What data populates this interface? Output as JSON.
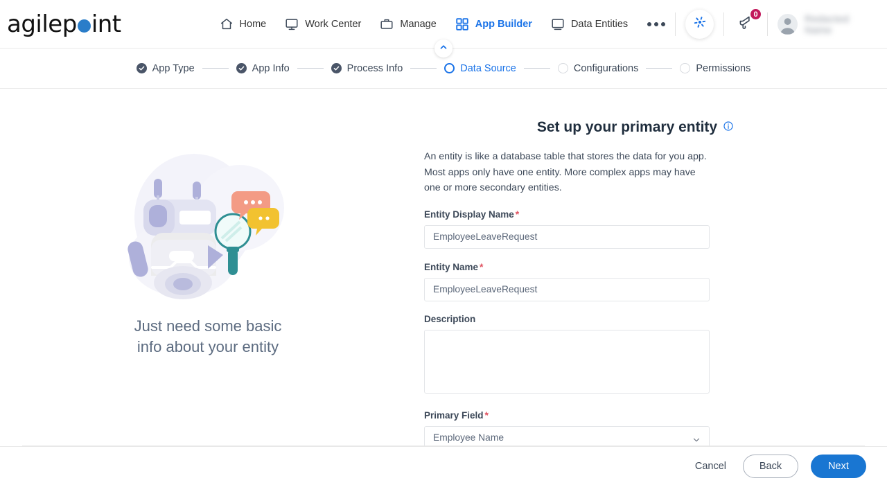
{
  "brand": {
    "name_part1": "agilep",
    "name_part2": "int",
    "dot_color": "#2a7dc9",
    "accent_color": "#1a73e8"
  },
  "nav": {
    "items": [
      {
        "label": "Home",
        "icon": "home-icon",
        "active": false
      },
      {
        "label": "Work Center",
        "icon": "monitor-icon",
        "active": false
      },
      {
        "label": "Manage",
        "icon": "briefcase-icon",
        "active": false
      },
      {
        "label": "App Builder",
        "icon": "grid-icon",
        "active": true
      },
      {
        "label": "Data Entities",
        "icon": "display-icon",
        "active": false
      }
    ],
    "more_label": "More"
  },
  "topbar_right": {
    "apps_icon": "pinwheel-icon",
    "announcement_icon": "megaphone-icon",
    "announcement_count": "0",
    "badge_color": "#c2185b",
    "avatar_icon": "user-avatar-icon",
    "user_name": "Redacted Name"
  },
  "wizard": {
    "collapse_icon": "chevron-up-icon",
    "steps": [
      {
        "label": "App Type",
        "state": "done"
      },
      {
        "label": "App Info",
        "state": "done"
      },
      {
        "label": "Process Info",
        "state": "done"
      },
      {
        "label": "Data Source",
        "state": "active"
      },
      {
        "label": "Configurations",
        "state": "todo"
      },
      {
        "label": "Permissions",
        "state": "todo"
      }
    ]
  },
  "illustration": {
    "caption_line1": "Just need some basic",
    "caption_line2": "info about your entity",
    "alt": "robot-with-magnifier-illustration"
  },
  "form": {
    "title": "Set up your primary entity",
    "title_info_icon": "info-icon",
    "description": "An entity is like a database table that stores the data for you app. Most apps only have one entity. More complex apps may have one or more secondary entities.",
    "fields": {
      "entity_display_name": {
        "label": "Entity Display Name",
        "required": true,
        "value": "EmployeeLeaveRequest",
        "placeholder": ""
      },
      "entity_name": {
        "label": "Entity Name",
        "required": true,
        "value": "EmployeeLeaveRequest",
        "placeholder": ""
      },
      "description": {
        "label": "Description",
        "required": false,
        "value": "",
        "placeholder": ""
      },
      "primary_field": {
        "label": "Primary Field",
        "required": true,
        "value": "Employee Name",
        "chevron_icon": "chevron-down-icon"
      }
    }
  },
  "footer": {
    "cancel_label": "Cancel",
    "back_label": "Back",
    "next_label": "Next",
    "next_color": "#1976d2"
  }
}
